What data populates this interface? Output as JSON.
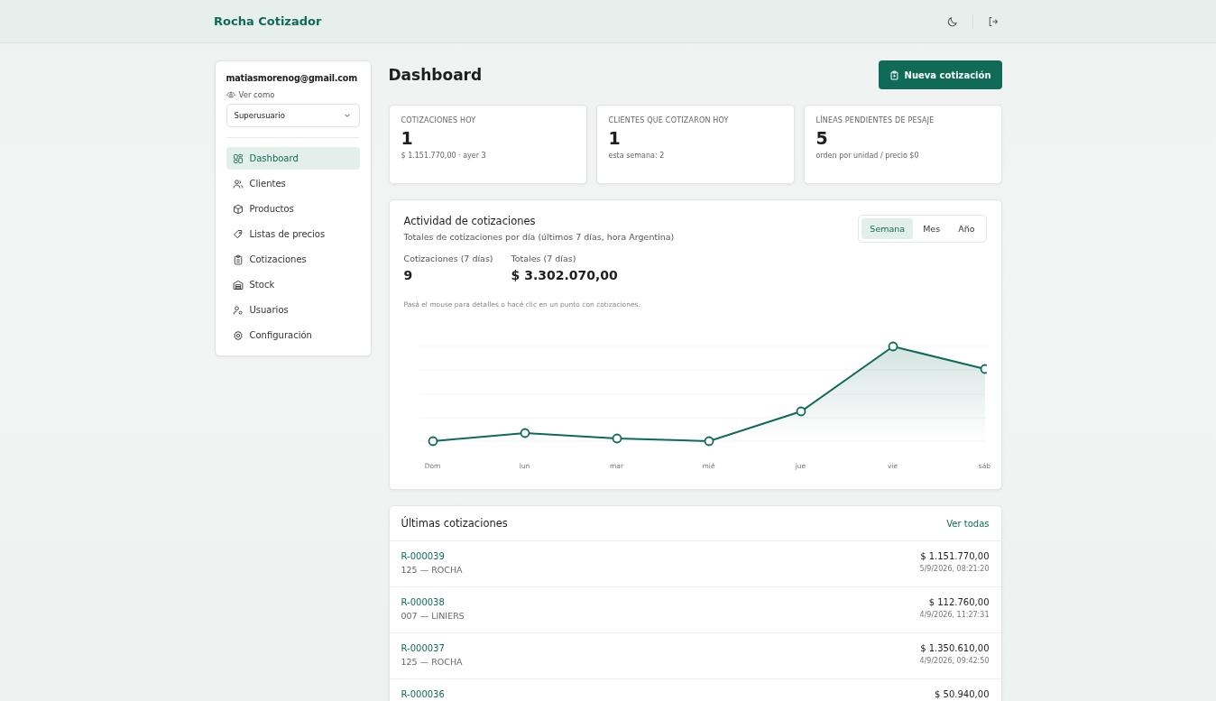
{
  "app": {
    "title": "Rocha Cotizador"
  },
  "user": {
    "email": "matiasmorenog@gmail.com",
    "view_as_label": "Ver como",
    "view_as_value": "Superusuario"
  },
  "sidebar": {
    "items": [
      {
        "label": "Dashboard",
        "selected": true
      },
      {
        "label": "Clientes",
        "selected": false
      },
      {
        "label": "Productos",
        "selected": false
      },
      {
        "label": "Listas de precios",
        "selected": false
      },
      {
        "label": "Cotizaciones",
        "selected": false
      },
      {
        "label": "Stock",
        "selected": false
      },
      {
        "label": "Usuarios",
        "selected": false
      },
      {
        "label": "Configuración",
        "selected": false
      }
    ]
  },
  "page": {
    "title": "Dashboard",
    "primary_button": "Nueva cotización"
  },
  "stats": [
    {
      "label": "COTIZACIONES HOY",
      "value": "1",
      "note": "$ 1.151.770,00 · ayer 3"
    },
    {
      "label": "CLIENTES QUE COTIZARON HOY",
      "value": "1",
      "note": "esta semana: 2"
    },
    {
      "label": "LÍNEAS PENDIENTES DE PESAJE",
      "value": "5",
      "note": "orden por unidad / precio $0"
    }
  ],
  "activity": {
    "title": "Actividad de cotizaciones",
    "subtitle": "Totales de cotizaciones por día (últimos 7 días, hora Argentina)",
    "ranges": [
      {
        "label": "Semana",
        "selected": true
      },
      {
        "label": "Mes",
        "selected": false
      },
      {
        "label": "Año",
        "selected": false
      }
    ],
    "metrics": [
      {
        "label": "Cotizaciones (7 días)",
        "value": "9"
      },
      {
        "label": "Totales (7 días)",
        "value": "$ 3.302.070,00"
      }
    ],
    "hint": "Pasá el mouse para detalles o hacé clic en un punto con cotizaciones.",
    "day_labels": [
      "Dom",
      "lun",
      "mar",
      "mié",
      "jue",
      "vie",
      "sáb"
    ]
  },
  "recent": {
    "title": "Últimas cotizaciones",
    "link": "Ver todas",
    "rows": [
      {
        "code": "R-000039",
        "client": "125 — ROCHA",
        "amount": "$ 1.151.770,00",
        "date": "5/9/2026, 08:21:20"
      },
      {
        "code": "R-000038",
        "client": "007 — LINIERS",
        "amount": "$ 112.760,00",
        "date": "4/9/2026, 11:27:31"
      },
      {
        "code": "R-000037",
        "client": "125 — ROCHA",
        "amount": "$ 1.350.610,00",
        "date": "4/9/2026, 09:42:50"
      },
      {
        "code": "R-000036",
        "amount": "$ 50.940,00"
      }
    ]
  }
}
